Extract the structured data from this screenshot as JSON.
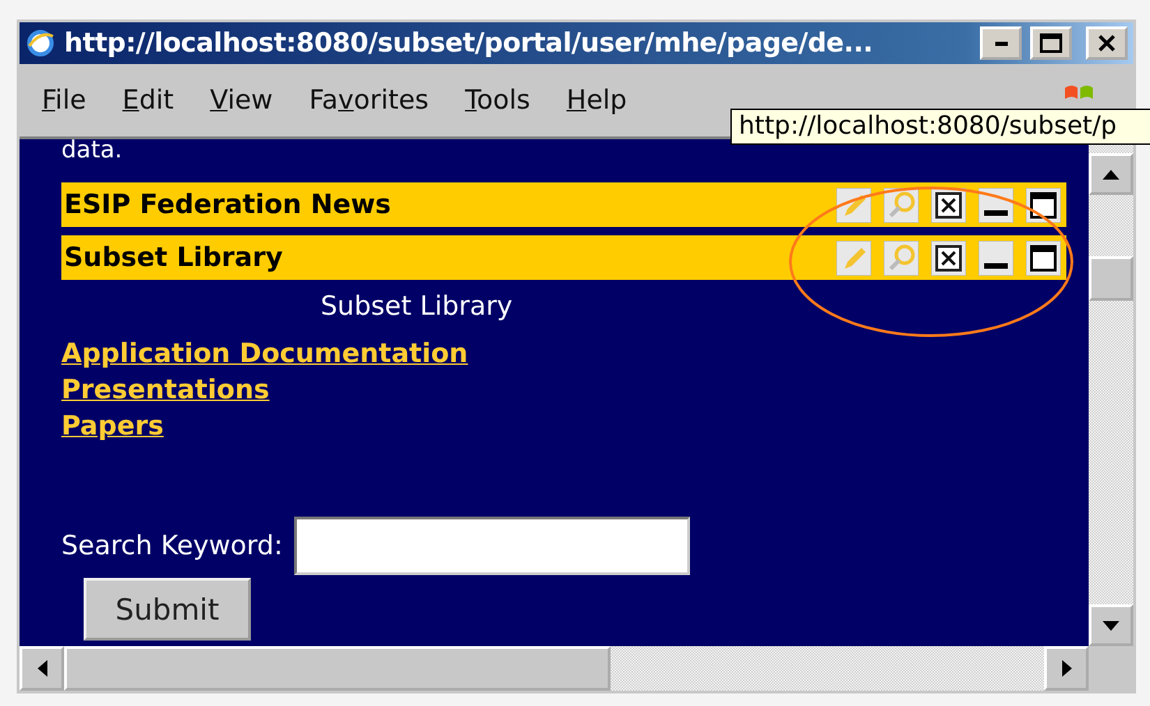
{
  "window": {
    "title": "http://localhost:8080/subset/portal/user/mhe/page/de..."
  },
  "menu": [
    {
      "label": "File"
    },
    {
      "label": "Edit"
    },
    {
      "label": "View"
    },
    {
      "label": "Favorites"
    },
    {
      "label": "Tools"
    },
    {
      "label": "Help"
    }
  ],
  "tooltip": "http://localhost:8080/subset/p",
  "page": {
    "clipped_text": "data.",
    "portlets": [
      {
        "title": "ESIP Federation News"
      },
      {
        "title": "Subset Library"
      }
    ],
    "caption": "Subset Library",
    "links": [
      "Application Documentation",
      "Presentations",
      "Papers"
    ],
    "search": {
      "label": "Search Keyword:"
    },
    "submit": "Submit"
  }
}
